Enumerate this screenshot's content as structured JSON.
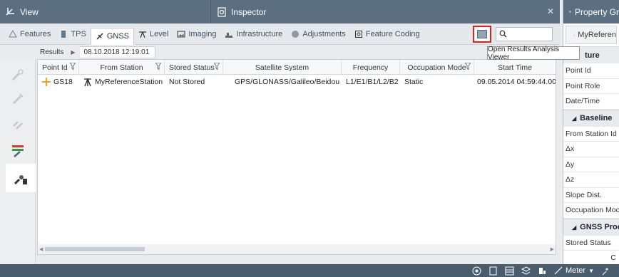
{
  "titlebar": {
    "view_title": "View",
    "inspector_title": "Inspector",
    "close_glyph": "✕"
  },
  "tabs": [
    {
      "label": "Features",
      "icon": "features-icon"
    },
    {
      "label": "TPS",
      "icon": "tps-icon"
    },
    {
      "label": "GNSS",
      "icon": "gnss-icon",
      "active": true
    },
    {
      "label": "Level",
      "icon": "level-icon"
    },
    {
      "label": "Imaging",
      "icon": "imaging-icon"
    },
    {
      "label": "Infrastructure",
      "icon": "infrastructure-icon"
    },
    {
      "label": "Adjustments",
      "icon": "adjustments-icon"
    },
    {
      "label": "Feature Coding",
      "icon": "feature-coding-icon"
    }
  ],
  "search": {
    "value": "",
    "placeholder": ""
  },
  "tooltip": "Open Results Analysis Viewer",
  "breadcrumb": {
    "root": "Results",
    "date": "08.10.2018 12:19:01"
  },
  "grid": {
    "columns": [
      "Point Id",
      "From Station",
      "Stored Status",
      "Satellite System",
      "Frequency",
      "Occupation Mode",
      "Start Time"
    ],
    "rows": [
      {
        "point_id": "GS18",
        "from_station": "MyReferenceStation",
        "stored_status": "Not Stored",
        "satellite_system": "GPS/GLONASS/Galileo/Beidou",
        "frequency": "L1/E1/B1/L2/B2",
        "occupation_mode": "Static",
        "start_time": "09.05.2014 04:59:44.00"
      }
    ]
  },
  "property_panel": {
    "title": "Property Gr",
    "reference": "MyReferen",
    "feature_section": "ture",
    "feature_items": [
      "Point Id",
      "Point Role",
      "Date/Time"
    ],
    "baseline_section": "Baseline",
    "baseline_items": [
      "From Station Id",
      "Δx",
      "Δy",
      "Δz",
      "Slope Dist.",
      "Occupation Moc"
    ],
    "gnss_section": "GNSS Proce",
    "gnss_items": [
      "Stored Status"
    ],
    "bottom_button": "C"
  },
  "status_bar": {
    "unit": "Meter"
  }
}
